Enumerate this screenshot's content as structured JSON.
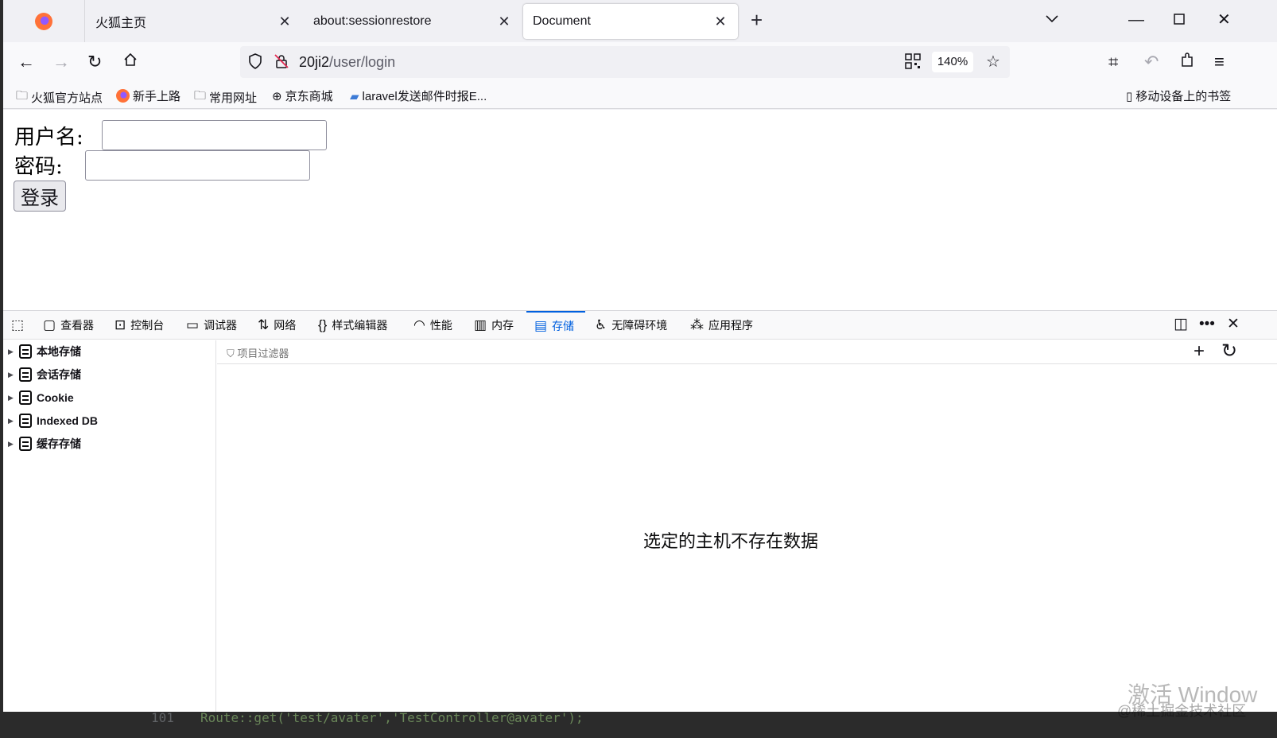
{
  "tabs": [
    {
      "label": "火狐主页"
    },
    {
      "label": "about:sessionrestore"
    },
    {
      "label": "Document"
    }
  ],
  "nav": {
    "url_host": "20ji2",
    "url_path": "/user/login",
    "zoom": "140%"
  },
  "bookmarks": [
    {
      "label": "火狐官方站点"
    },
    {
      "label": "新手上路"
    },
    {
      "label": "常用网址"
    },
    {
      "label": "京东商城"
    },
    {
      "label": "laravel发送邮件时报E..."
    }
  ],
  "mobile_bookmarks": "移动设备上的书签",
  "form": {
    "username_label": "用户名:",
    "password_label": "密码:",
    "login_button": "登录"
  },
  "devtools": {
    "tabs": [
      {
        "label": "查看器"
      },
      {
        "label": "控制台"
      },
      {
        "label": "调试器"
      },
      {
        "label": "网络"
      },
      {
        "label": "样式编辑器"
      },
      {
        "label": "性能"
      },
      {
        "label": "内存"
      },
      {
        "label": "存储"
      },
      {
        "label": "无障碍环境"
      },
      {
        "label": "应用程序"
      }
    ],
    "active_tab": "存储",
    "storage_tree": [
      {
        "label": "本地存储"
      },
      {
        "label": "会话存储"
      },
      {
        "label": "Cookie"
      },
      {
        "label": "Indexed DB"
      },
      {
        "label": "缓存存储"
      }
    ],
    "filter_placeholder": "项目过滤器",
    "empty_message": "选定的主机不存在数据"
  },
  "background_code": {
    "line_number": "101",
    "code": "Route::get('test/avater','TestController@avater');"
  },
  "watermark": {
    "line1": "激活 Window",
    "line2": "@稀土掘金技术社区"
  },
  "colors": {
    "accent": "#0060df",
    "tab_bg": "#f0f0f4"
  }
}
